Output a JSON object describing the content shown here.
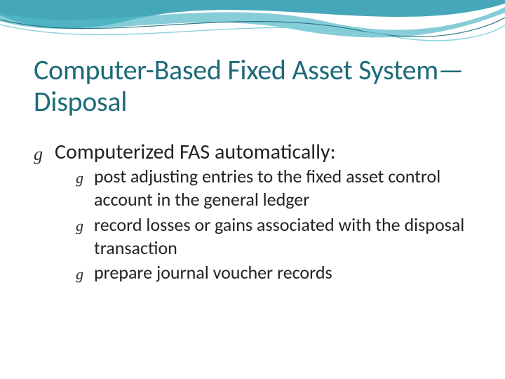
{
  "title": "Computer-Based Fixed Asset System—Disposal",
  "heading": "Computerized FAS automatically:",
  "items": [
    "post adjusting entries to the fixed asset control account in the general ledger",
    "record losses or gains associated with the disposal transaction",
    "prepare journal voucher records"
  ]
}
